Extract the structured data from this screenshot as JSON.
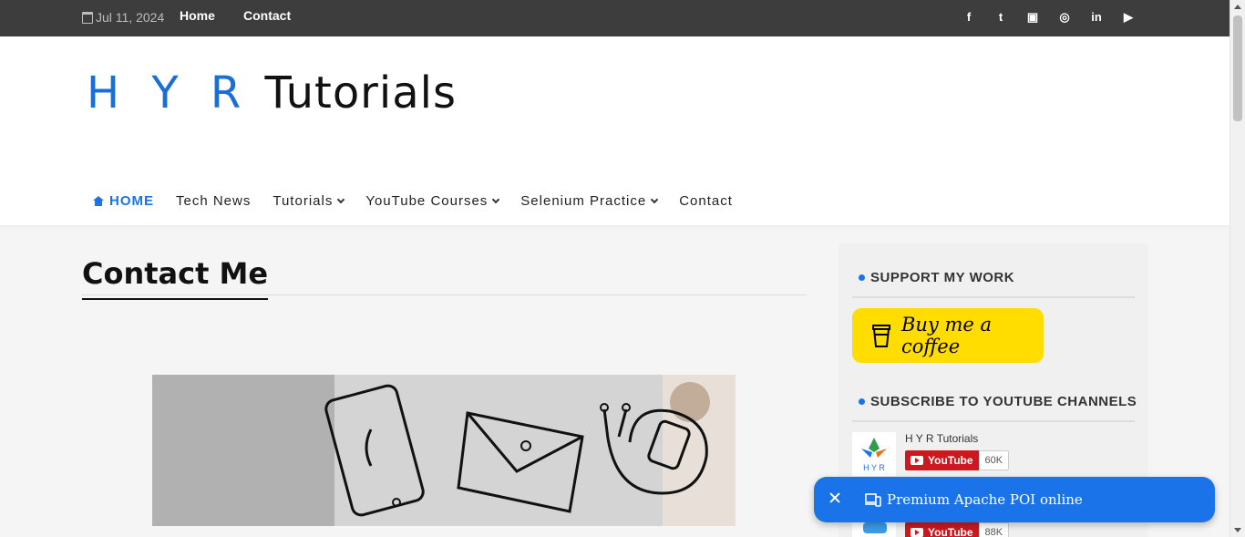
{
  "topbar": {
    "date": "Jul 11, 2024",
    "links": [
      "Home",
      "Contact"
    ],
    "social": [
      {
        "icon": "facebook-icon",
        "glyph": "f"
      },
      {
        "icon": "twitter-icon",
        "glyph": "t"
      },
      {
        "icon": "discord-icon",
        "glyph": "▣"
      },
      {
        "icon": "instagram-icon",
        "glyph": "◎"
      },
      {
        "icon": "linkedin-icon",
        "glyph": "in"
      },
      {
        "icon": "youtube-icon",
        "glyph": "▶"
      }
    ]
  },
  "header": {
    "logo_part1": "H Y R",
    "logo_part2": " Tutorials"
  },
  "nav": {
    "items": [
      "HOME",
      "Tech News",
      "Tutorials",
      "YouTube Courses",
      "Selenium Practice",
      "Contact"
    ]
  },
  "main": {
    "title": "Contact Me"
  },
  "sidebar": {
    "support_title": "SUPPORT MY WORK",
    "coffee_label": "Buy me a coffee",
    "subscribe_title": "SUBSCRIBE TO YOUTUBE CHANNELS",
    "channels": [
      {
        "name": "H Y R Tutorials",
        "button": "YouTube",
        "count": "60K"
      },
      {
        "name": "",
        "button": "YouTube",
        "count": "88K"
      }
    ]
  },
  "toast": {
    "text": "Premium Apache POI online"
  },
  "colors": {
    "accent": "#1a73e8",
    "topbar": "#3d3d3d",
    "coffee": "#ffdd00",
    "youtube": "#cc181e"
  }
}
